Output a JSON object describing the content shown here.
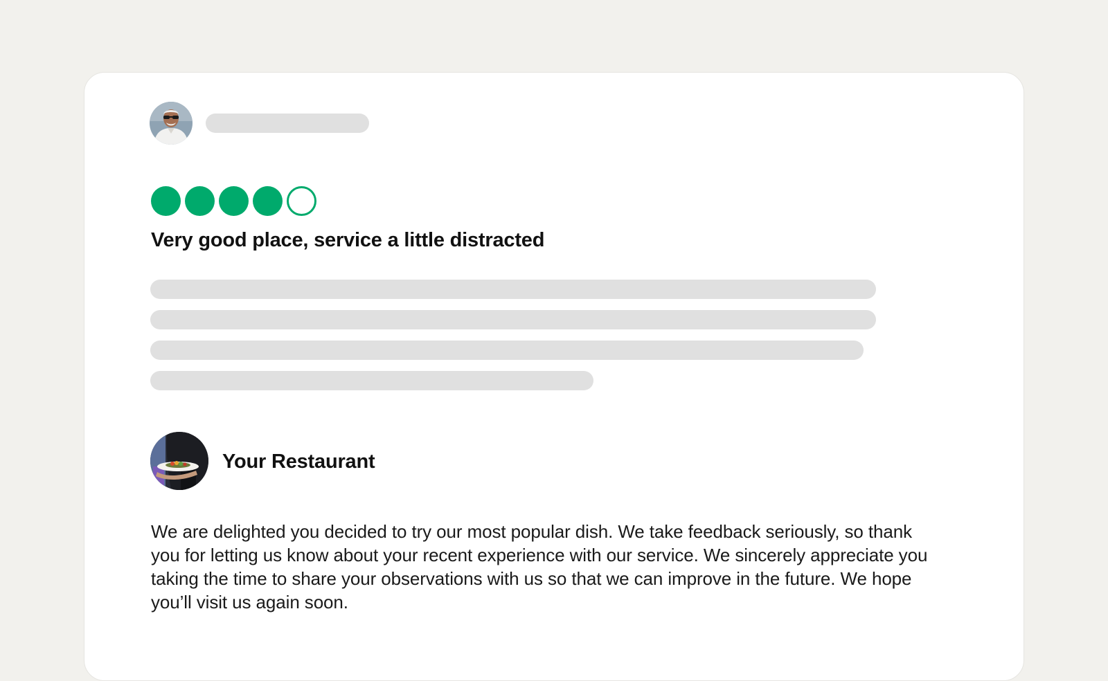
{
  "review": {
    "rating": 4,
    "rating_max": 5,
    "rating_color": "#00aa6c",
    "title": "Very good place, service a little distracted",
    "reviewer_avatar_icon": "elderly-man-sunglasses-avatar",
    "body_placeholder_lines": 4
  },
  "owner_reply": {
    "name": "Your Restaurant",
    "avatar_icon": "waiter-serving-dish-avatar",
    "text": "We are delighted you decided to try our most popular dish. We take feedback seriously, so thank you for letting us know about your recent experience with our service. We sincerely appreciate you taking the time to share your observations with us so that we can improve in the future. We hope you’ll visit us again soon."
  },
  "colors": {
    "background": "#f2f1ed",
    "card": "#ffffff",
    "skeleton": "#e0e0e0"
  }
}
